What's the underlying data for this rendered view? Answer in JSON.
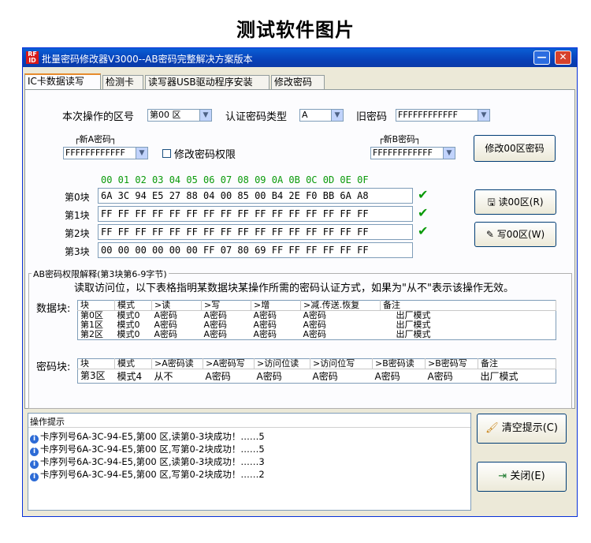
{
  "page_title": "测试软件图片",
  "window": {
    "icon_text": "RF ID",
    "title": "批量密码修改器V3000--AB密码完整解决方案版本",
    "min_glyph": "—",
    "close_glyph": "✕"
  },
  "tabs": [
    "IC卡数据读写",
    "检测卡",
    "读写器USB驱动程序安装",
    "修改密码"
  ],
  "form": {
    "sector_label": "本次操作的区号",
    "sector_value": "第00 区",
    "auth_label": "认证密码类型",
    "auth_value": "A",
    "old_pwd_label": "旧密码",
    "old_pwd_value": "FFFFFFFFFFFF",
    "newA_label": "新A密码",
    "newA_value": "FFFFFFFFFFFF",
    "modify_rights_label": "修改密码权限",
    "newB_label": "新B密码",
    "newB_value": "FFFFFFFFFFFF",
    "modify_btn": "修改00区密码"
  },
  "hex": {
    "header": "00 01 02 03 04 05 06 07 08 09 0A 0B 0C 0D 0E 0F",
    "rows": [
      {
        "label": "第0块",
        "data": "6A 3C 94 E5 27 88 04 00 85 00 B4 2E F0 BB 6A A8",
        "check": "✔"
      },
      {
        "label": "第1块",
        "data": "FF FF FF FF FF FF FF FF FF FF FF FF FF FF FF FF",
        "check": "✔"
      },
      {
        "label": "第2块",
        "data": "FF FF FF FF FF FF FF FF FF FF FF FF FF FF FF FF",
        "check": "✔"
      },
      {
        "label": "第3块",
        "data": "00 00 00 00 00 00 FF 07 80 69 FF FF FF FF FF FF",
        "check": ""
      }
    ],
    "read_btn": "读00区(R)",
    "write_btn": "写00区(W)"
  },
  "ab": {
    "group_title": "AB密码权限解释(第3块第6-9字节)",
    "desc": "读取访问位，以下表格指明某数据块某操作所需的密码认证方式，如果为\"从不\"表示该操作无效。",
    "data_label": "数据块:",
    "data_headers": [
      "块",
      "模式",
      ">读",
      ">写",
      ">增",
      ">减.传送.恢复",
      "备注"
    ],
    "data_rows": [
      [
        "第0区",
        "模式0",
        "A密码",
        "A密码",
        "A密码",
        "A密码",
        "出厂模式"
      ],
      [
        "第1区",
        "模式0",
        "A密码",
        "A密码",
        "A密码",
        "A密码",
        "出厂模式"
      ],
      [
        "第2区",
        "模式0",
        "A密码",
        "A密码",
        "A密码",
        "A密码",
        "出厂模式"
      ]
    ],
    "key_label": "密码块:",
    "key_headers": [
      "块",
      "模式",
      ">A密码读",
      ">A密码写",
      ">访问位读",
      ">访问位写",
      ">B密码读",
      ">B密码写",
      "备注"
    ],
    "key_row": [
      "第3区",
      "模式4",
      "从不",
      "A密码",
      "A密码",
      "A密码",
      "A密码",
      "A密码",
      "出厂模式"
    ]
  },
  "log": {
    "title": "操作提示",
    "lines": [
      "卡序列号6A-3C-94-E5,第00 区,读第0-3块成功！……5",
      "卡序列号6A-3C-94-E5,第00 区,写第0-2块成功！……5",
      "卡序列号6A-3C-94-E5,第00 区,读第0-3块成功！……3",
      "卡序列号6A-3C-94-E5,第00 区,写第0-2块成功！……2"
    ],
    "info_glyph": "i",
    "clear_btn": "清空提示(C)",
    "close_btn": "关闭(E)"
  }
}
